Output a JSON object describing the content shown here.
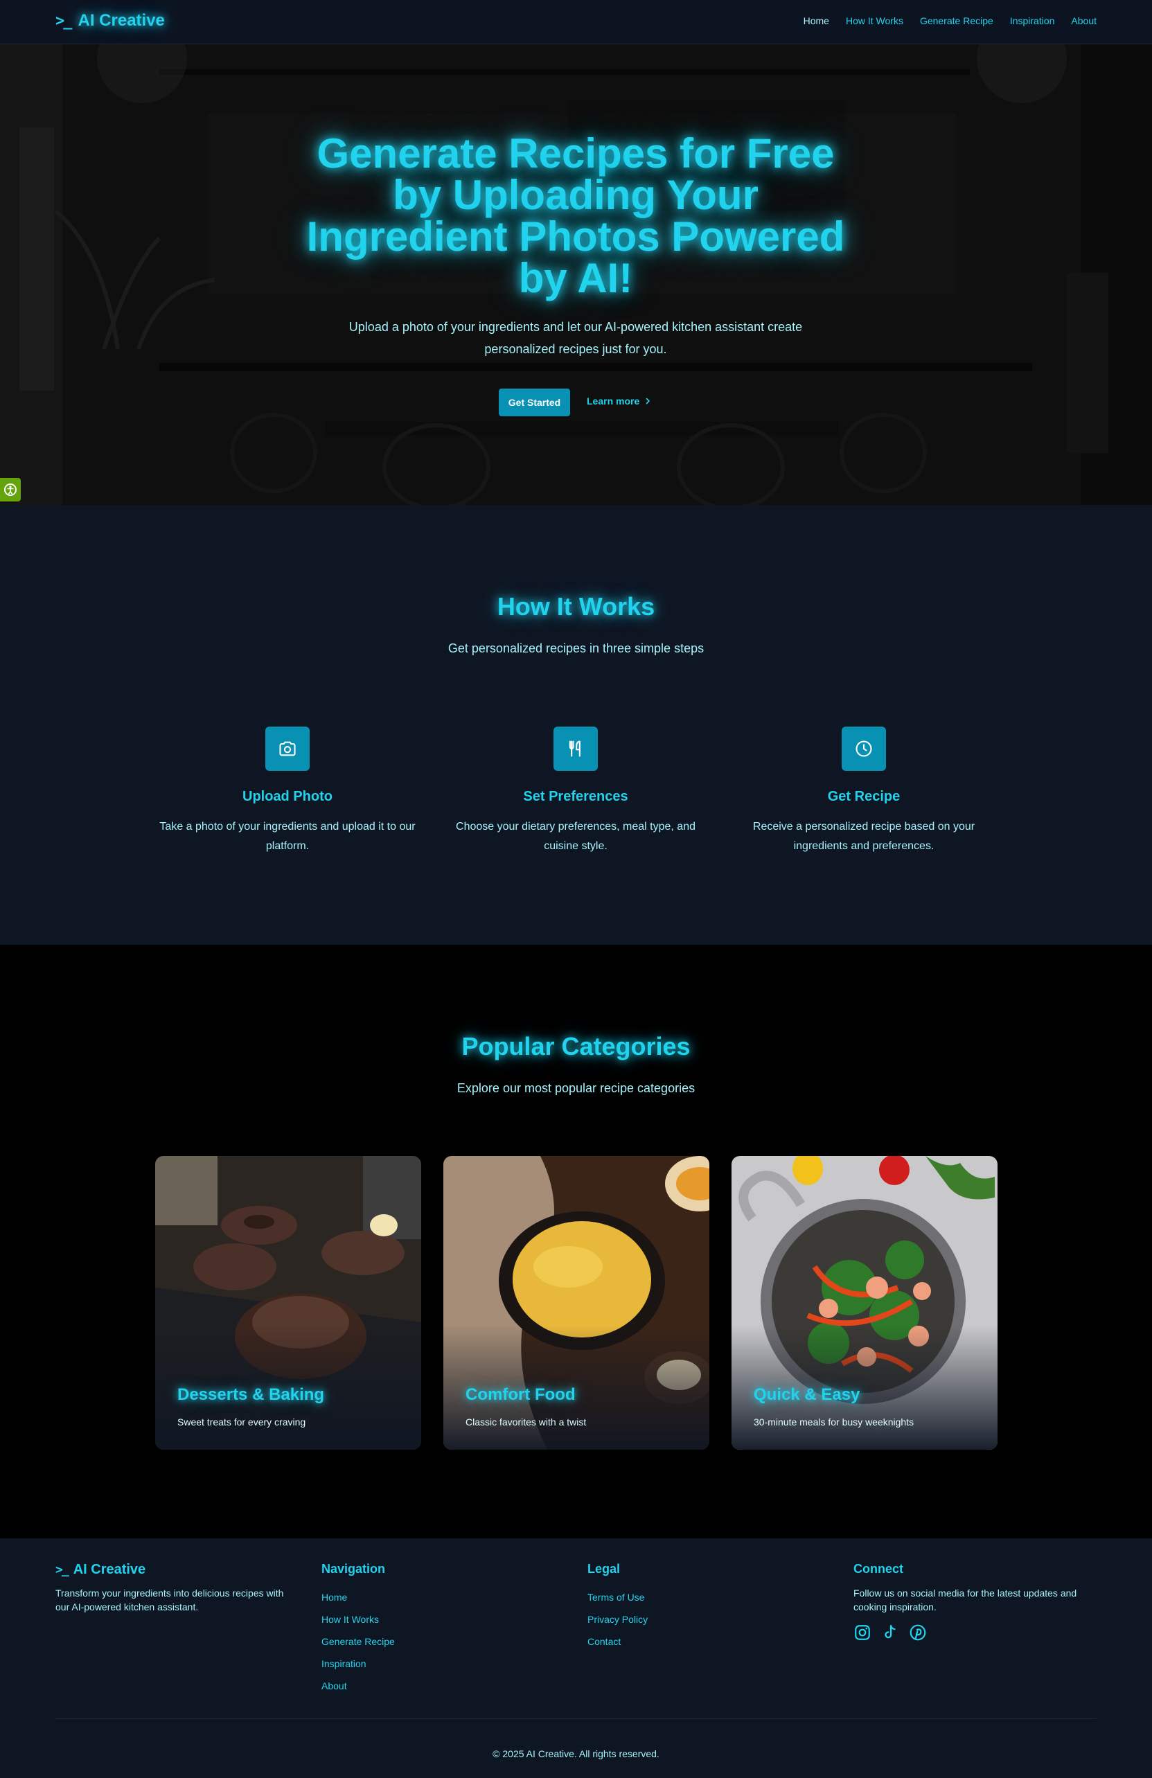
{
  "header": {
    "logo_mark": ">_",
    "brand": "AI Creative",
    "nav": [
      "Home",
      "How It Works",
      "Generate Recipe",
      "Inspiration",
      "About"
    ],
    "active_nav": "Home"
  },
  "hero": {
    "title": "Generate Recipes for Free by Uploading Your Ingredient Photos Powered by AI!",
    "subtitle": "Upload a photo of your ingredients and let our AI-powered kitchen assistant create personalized recipes just for you.",
    "primary_button": "Get Started",
    "secondary_link": "Learn more",
    "secondary_icon": "chevron-right-icon"
  },
  "how": {
    "title": "How It Works",
    "subtitle": "Get personalized recipes in three simple steps",
    "steps": [
      {
        "icon": "camera-icon",
        "title": "Upload Photo",
        "desc": "Take a photo of your ingredients and upload it to our platform."
      },
      {
        "icon": "utensils-icon",
        "title": "Set Preferences",
        "desc": "Choose your dietary preferences, meal type, and cuisine style."
      },
      {
        "icon": "clock-icon",
        "title": "Get Recipe",
        "desc": "Receive a personalized recipe based on your ingredients and preferences."
      }
    ]
  },
  "categories": {
    "title": "Popular Categories",
    "subtitle": "Explore our most popular recipe categories",
    "cards": [
      {
        "title": "Desserts & Baking",
        "subtitle": "Sweet treats for every craving"
      },
      {
        "title": "Comfort Food",
        "subtitle": "Classic favorites with a twist"
      },
      {
        "title": "Quick & Easy",
        "subtitle": "30-minute meals for busy weeknights"
      }
    ]
  },
  "footer": {
    "brand": "AI Creative",
    "brand_text": "Transform your ingredients into delicious recipes with our AI-powered kitchen assistant.",
    "navigation_title": "Navigation",
    "navigation": [
      "Home",
      "How It Works",
      "Generate Recipe",
      "Inspiration",
      "About"
    ],
    "legal_title": "Legal",
    "legal": [
      "Terms of Use",
      "Privacy Policy",
      "Contact"
    ],
    "connect_title": "Connect",
    "connect_text": "Follow us on social media for the latest updates and cooking inspiration.",
    "social": [
      "instagram-icon",
      "tiktok-icon",
      "pinterest-icon"
    ],
    "copyright": "© 2025 AI Creative. All rights reserved."
  },
  "colors": {
    "accent": "#22d3ee",
    "button": "#0891b2",
    "text_light": "#a5f3fc",
    "header_bg": "#0d1421",
    "section_bg": "#0f1623",
    "accessibility": "#65a30d"
  }
}
